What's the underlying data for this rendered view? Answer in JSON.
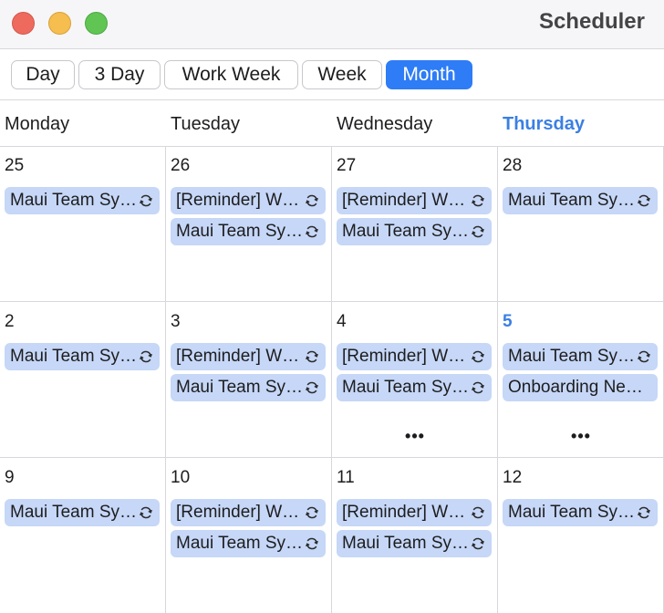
{
  "window": {
    "title": "Scheduler"
  },
  "toolbar": {
    "views": [
      "Day",
      "3 Day",
      "Work Week",
      "Week",
      "Month"
    ],
    "active": "Month"
  },
  "day_headers": [
    {
      "label": "Monday",
      "today": false
    },
    {
      "label": "Tuesday",
      "today": false
    },
    {
      "label": "Wednesday",
      "today": false
    },
    {
      "label": "Thursday",
      "today": true
    }
  ],
  "weeks": [
    {
      "days": [
        {
          "day": "25",
          "today": false,
          "events": [
            {
              "title": "Maui Team Sy…",
              "recurring": true
            }
          ],
          "more": ""
        },
        {
          "day": "26",
          "today": false,
          "events": [
            {
              "title": "[Reminder] W…",
              "recurring": true
            },
            {
              "title": "Maui Team Sy…",
              "recurring": true
            }
          ],
          "more": ""
        },
        {
          "day": "27",
          "today": false,
          "events": [
            {
              "title": "[Reminder] W…",
              "recurring": true
            },
            {
              "title": "Maui Team Sy…",
              "recurring": true
            }
          ],
          "more": ""
        },
        {
          "day": "28",
          "today": false,
          "events": [
            {
              "title": "Maui Team Sy…",
              "recurring": true
            }
          ],
          "more": ""
        }
      ]
    },
    {
      "days": [
        {
          "day": "2",
          "today": false,
          "events": [
            {
              "title": "Maui Team Sy…",
              "recurring": true
            }
          ],
          "more": ""
        },
        {
          "day": "3",
          "today": false,
          "events": [
            {
              "title": "[Reminder] W…",
              "recurring": true
            },
            {
              "title": "Maui Team Sy…",
              "recurring": true
            }
          ],
          "more": ""
        },
        {
          "day": "4",
          "today": false,
          "events": [
            {
              "title": "[Reminder] W…",
              "recurring": true
            },
            {
              "title": "Maui Team Sy…",
              "recurring": true
            }
          ],
          "more": "•••"
        },
        {
          "day": "5",
          "today": true,
          "events": [
            {
              "title": "Maui Team Sy…",
              "recurring": true
            },
            {
              "title": "Onboarding Ne…",
              "recurring": false
            }
          ],
          "more": "•••"
        }
      ]
    },
    {
      "days": [
        {
          "day": "9",
          "today": false,
          "events": [
            {
              "title": "Maui Team Sy…",
              "recurring": true
            }
          ],
          "more": ""
        },
        {
          "day": "10",
          "today": false,
          "events": [
            {
              "title": "[Reminder] W…",
              "recurring": true
            },
            {
              "title": "Maui Team Sy…",
              "recurring": true
            }
          ],
          "more": ""
        },
        {
          "day": "11",
          "today": false,
          "events": [
            {
              "title": "[Reminder] W…",
              "recurring": true
            },
            {
              "title": "Maui Team Sy…",
              "recurring": true
            }
          ],
          "more": ""
        },
        {
          "day": "12",
          "today": false,
          "events": [
            {
              "title": "Maui Team Sy…",
              "recurring": true
            }
          ],
          "more": ""
        }
      ]
    }
  ],
  "colors": {
    "accent": "#2e7cf6",
    "today_text": "#3b7fe3",
    "event_fill": "#c6d7f7",
    "close_button": "#ee6a5f",
    "minimize_button": "#f5be4f",
    "zoom_button": "#61c554"
  }
}
